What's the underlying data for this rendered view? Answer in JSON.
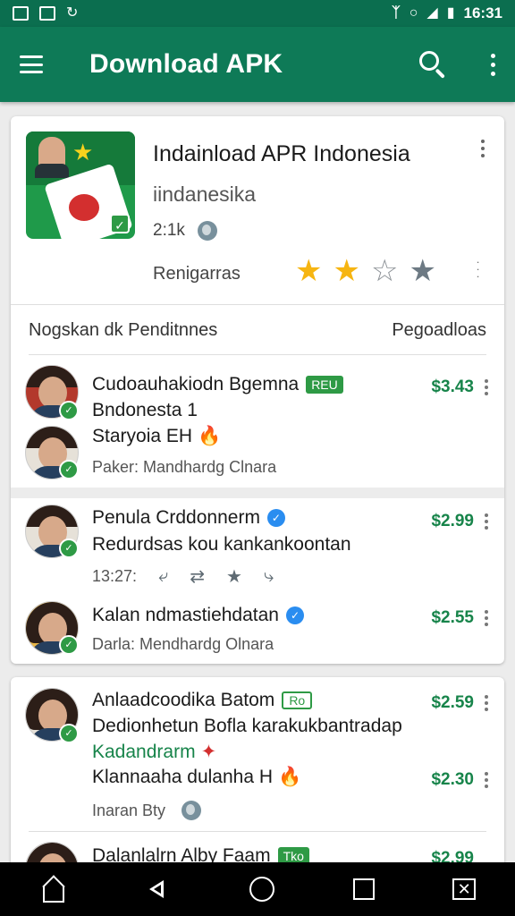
{
  "status_bar": {
    "time": "16:31",
    "left_icons": [
      "image-icon",
      "cast-icon",
      "sync-icon"
    ],
    "right_icons": [
      "bluetooth-icon",
      "wifi-icon",
      "signal-icon",
      "battery-icon"
    ]
  },
  "app_bar": {
    "title": "Download APK",
    "icons": [
      "menu-icon",
      "search-icon",
      "more-vert-icon"
    ]
  },
  "featured": {
    "title": "Indainload APR Indonesia",
    "subtitle": "iindanesika",
    "size": "2:1k",
    "rating_label": "Renigarras",
    "rating": 2,
    "rating_max": 4
  },
  "section": {
    "left": "Nogskan dk Penditnnes",
    "right": "Pegoadloas"
  },
  "items": [
    {
      "name": "Cudoauhakiodn Bgemna",
      "tag": "REU",
      "line2": "Bndonesta 1",
      "line3": "Staryoia EH",
      "meta": "Paker: Mandhardg Clnara",
      "price": "$3.43"
    },
    {
      "name": "Penula Crddonnerm",
      "line2": "Redurdsas kou kankankoontan",
      "time": "13:27:",
      "price": "$2.99"
    },
    {
      "name": "Kalan ndmastiehdatan",
      "meta": "Darla: Mendhardg Olnara",
      "price": "$2.55"
    }
  ],
  "items2": [
    {
      "name": "Anlaadcoodika Batom",
      "tag": "Ro",
      "line2": "Dedionhetun Bofla karakukbantradap",
      "line3": "Kadandrarm",
      "price": "$2.59"
    },
    {
      "name": "Klannaaha dulanha H",
      "meta": "Inaran Bty",
      "price": "$2.30"
    },
    {
      "name": "Dalanlalrn Alby Faam",
      "tag": "Tko",
      "price": "$2.99"
    }
  ],
  "colors": {
    "app_bar": "#0e7a57",
    "status_bar": "#0b6e4f",
    "price": "#17844a",
    "star": "#f6b512",
    "verified": "#2a8df0"
  }
}
